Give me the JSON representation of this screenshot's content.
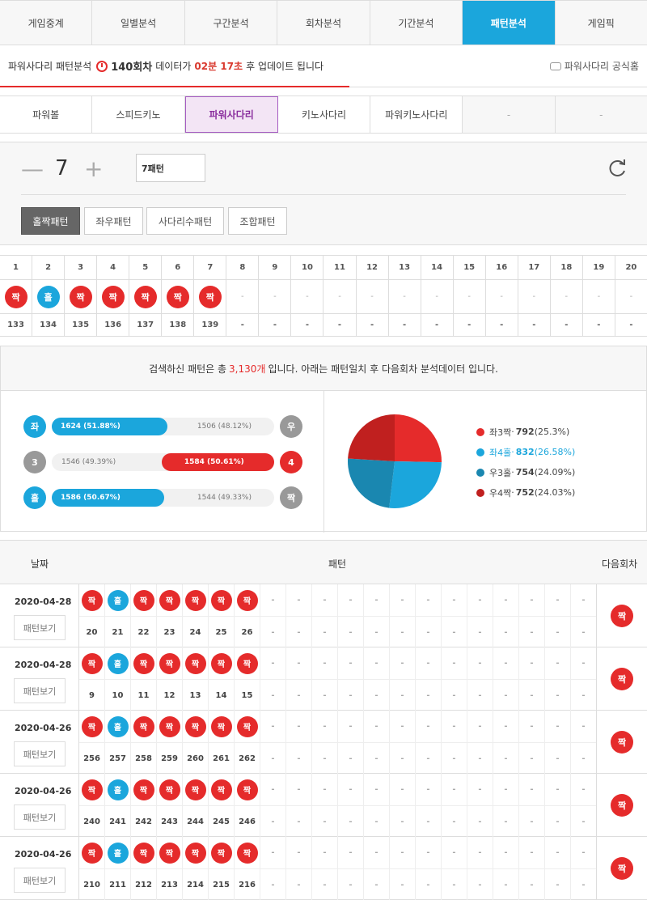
{
  "top_nav": [
    {
      "label": "게임중계",
      "active": false
    },
    {
      "label": "일별분석",
      "active": false
    },
    {
      "label": "구간분석",
      "active": false
    },
    {
      "label": "회차분석",
      "active": false
    },
    {
      "label": "기간분석",
      "active": false
    },
    {
      "label": "패턴분석",
      "active": true
    },
    {
      "label": "게임픽",
      "active": false
    }
  ],
  "info": {
    "prefix": "파워사다리 패턴분석",
    "round": "140회차",
    "data_text": "데이터가",
    "countdown": "02분 17초",
    "suffix": "후 업데이트 됩니다",
    "official": "파워사다리 공식홈",
    "progress": 0.54
  },
  "sub_nav": [
    {
      "label": "파워볼",
      "active": false,
      "dim": false
    },
    {
      "label": "스피드키노",
      "active": false,
      "dim": false
    },
    {
      "label": "파워사다리",
      "active": true,
      "dim": false
    },
    {
      "label": "키노사다리",
      "active": false,
      "dim": false
    },
    {
      "label": "파워키노사다리",
      "active": false,
      "dim": false
    },
    {
      "label": "-",
      "active": false,
      "dim": true
    },
    {
      "label": "-",
      "active": false,
      "dim": true
    }
  ],
  "control": {
    "count": "7",
    "select_value": "7패턴",
    "pattern_buttons": [
      {
        "label": "홀짝패턴",
        "active": true
      },
      {
        "label": "좌우패턴",
        "active": false
      },
      {
        "label": "사다리수패턴",
        "active": false
      },
      {
        "label": "조합패턴",
        "active": false
      }
    ]
  },
  "current_pattern": {
    "headers": [
      "1",
      "2",
      "3",
      "4",
      "5",
      "6",
      "7",
      "8",
      "9",
      "10",
      "11",
      "12",
      "13",
      "14",
      "15",
      "16",
      "17",
      "18",
      "19",
      "20"
    ],
    "balls": [
      "짝",
      "홀",
      "짝",
      "짝",
      "짝",
      "짝",
      "짝",
      "-",
      "-",
      "-",
      "-",
      "-",
      "-",
      "-",
      "-",
      "-",
      "-",
      "-",
      "-",
      "-"
    ],
    "rounds": [
      "133",
      "134",
      "135",
      "136",
      "137",
      "138",
      "139",
      "-",
      "-",
      "-",
      "-",
      "-",
      "-",
      "-",
      "-",
      "-",
      "-",
      "-",
      "-",
      "-"
    ]
  },
  "stats": {
    "summary_prefix": "검색하신 패턴은 총",
    "summary_count": "3,130개",
    "summary_suffix": "입니다. 아래는 패턴일치 후 다음회차 분석데이터 입니다.",
    "bars": [
      {
        "left_label": "좌",
        "right_label": "우",
        "left_value": "1624 (51.88%)",
        "right_value": "1506 (48.12%)",
        "left_pct": 51.88,
        "winner": "left",
        "left_color": "#1ba6dc",
        "right_color": "#999999"
      },
      {
        "left_label": "3",
        "right_label": "4",
        "left_value": "1546 (49.39%)",
        "right_value": "1584 (50.61%)",
        "left_pct": 49.39,
        "winner": "right",
        "left_color": "#999999",
        "right_color": "#e52b2b"
      },
      {
        "left_label": "홀",
        "right_label": "짝",
        "left_value": "1586 (50.67%)",
        "right_value": "1544 (49.33%)",
        "left_pct": 50.67,
        "winner": "left",
        "left_color": "#1ba6dc",
        "right_color": "#999999"
      }
    ]
  },
  "chart_data": {
    "type": "pie",
    "categories": [
      "좌3짝",
      "좌4홀",
      "우3홀",
      "우4짝"
    ],
    "values": [
      792,
      832,
      754,
      752
    ],
    "percent_labels": [
      "(25.3%)",
      "(26.58%)",
      "(24.09%)",
      "(24.03%)"
    ],
    "colors": [
      "#e52b2b",
      "#1ba6dc",
      "#1a87b0",
      "#c0201f"
    ],
    "highlight": "좌4홀",
    "legend": "right"
  },
  "history": {
    "headers": {
      "date": "날짜",
      "pattern": "패턴",
      "next": "다음회차"
    },
    "view_label": "패턴보기",
    "rows": [
      {
        "date": "2020-04-28",
        "balls": [
          "짝",
          "홀",
          "짝",
          "짝",
          "짝",
          "짝",
          "짝"
        ],
        "rounds": [
          "20",
          "21",
          "22",
          "23",
          "24",
          "25",
          "26"
        ],
        "next": "짝"
      },
      {
        "date": "2020-04-28",
        "balls": [
          "짝",
          "홀",
          "짝",
          "짝",
          "짝",
          "짝",
          "짝"
        ],
        "rounds": [
          "9",
          "10",
          "11",
          "12",
          "13",
          "14",
          "15"
        ],
        "next": "짝"
      },
      {
        "date": "2020-04-26",
        "balls": [
          "짝",
          "홀",
          "짝",
          "짝",
          "짝",
          "짝",
          "짝"
        ],
        "rounds": [
          "256",
          "257",
          "258",
          "259",
          "260",
          "261",
          "262"
        ],
        "next": "짝"
      },
      {
        "date": "2020-04-26",
        "balls": [
          "짝",
          "홀",
          "짝",
          "짝",
          "짝",
          "짝",
          "짝"
        ],
        "rounds": [
          "240",
          "241",
          "242",
          "243",
          "244",
          "245",
          "246"
        ],
        "next": "짝"
      },
      {
        "date": "2020-04-26",
        "balls": [
          "짝",
          "홀",
          "짝",
          "짝",
          "짝",
          "짝",
          "짝"
        ],
        "rounds": [
          "210",
          "211",
          "212",
          "213",
          "214",
          "215",
          "216"
        ],
        "next": "짝"
      }
    ],
    "empty_cell": "-"
  },
  "colors": {
    "accent": "#1ba6dc",
    "red": "#e52b2b",
    "purple": "#8a2e9e"
  }
}
